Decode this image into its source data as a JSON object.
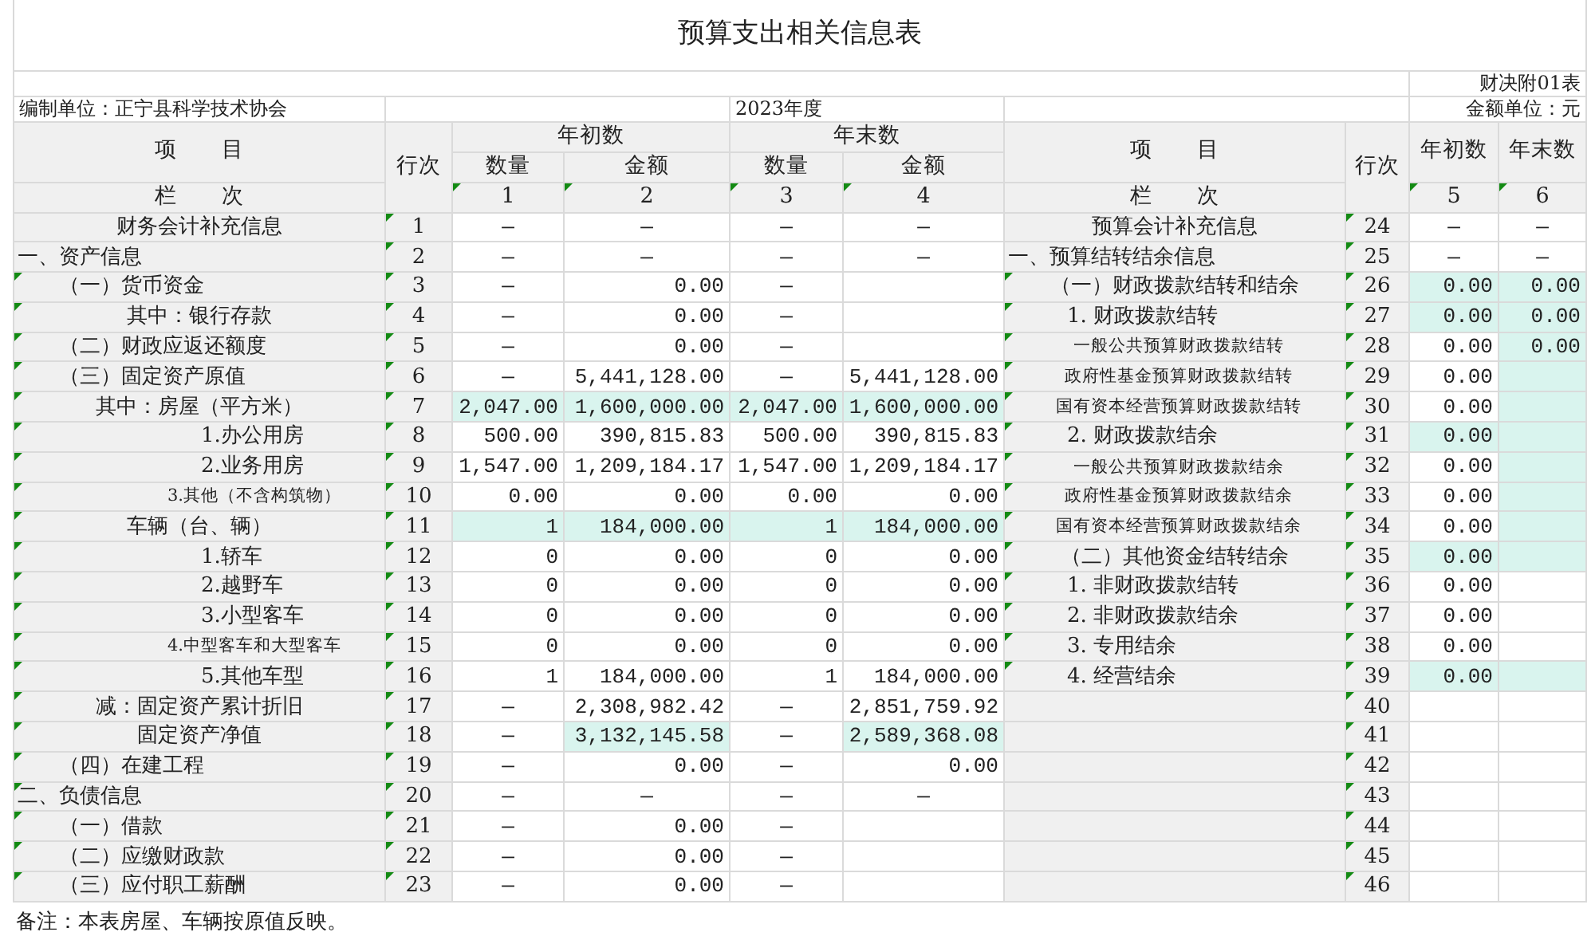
{
  "title": "预算支出相关信息表",
  "form_code": "财决附01表",
  "unit": "编制单位：正宁县科学技术协会",
  "period": "2023年度",
  "currency": "金额单位：元",
  "left_header": {
    "item": "项　　目",
    "line": "行次",
    "index_label": "栏　　次",
    "groups": [
      {
        "label": "年初数",
        "columns": [
          {
            "label": "数量",
            "index": "1",
            "marked": true
          },
          {
            "label": "金额",
            "index": "2",
            "marked": true
          }
        ]
      },
      {
        "label": "年末数",
        "columns": [
          {
            "label": "数量",
            "index": "3",
            "marked": true
          },
          {
            "label": "金额",
            "index": "4",
            "marked": true
          }
        ]
      }
    ]
  },
  "right_header": {
    "item": "项　　目",
    "line": "行次",
    "index_label": "栏　　次",
    "columns": [
      {
        "label": "年初数",
        "index": "5",
        "marked": true
      },
      {
        "label": "年末数",
        "index": "6",
        "marked": true
      }
    ]
  },
  "rows": [
    {
      "left": {
        "item": "财务会计补充信息",
        "kind": "center",
        "item_marked": false,
        "line": "1",
        "line_marked": true,
        "cells": [
          {
            "text": "—",
            "kind": "dash",
            "highlighted": false
          },
          {
            "text": "—",
            "kind": "dash",
            "highlighted": false
          },
          {
            "text": "—",
            "kind": "dash",
            "highlighted": false
          },
          {
            "text": "—",
            "kind": "dash",
            "highlighted": false
          }
        ]
      },
      "right": {
        "item": "预算会计补充信息",
        "kind": "center",
        "item_marked": false,
        "line": "24",
        "line_marked": true,
        "cells": [
          {
            "text": "—",
            "kind": "dash",
            "highlighted": false
          },
          {
            "text": "—",
            "kind": "dash",
            "highlighted": false
          }
        ]
      }
    },
    {
      "left": {
        "item": "一、资产信息",
        "kind": "section",
        "item_marked": false,
        "line": "2",
        "line_marked": true,
        "cells": [
          {
            "text": "—",
            "kind": "dash",
            "highlighted": false
          },
          {
            "text": "—",
            "kind": "dash",
            "highlighted": false
          },
          {
            "text": "—",
            "kind": "dash",
            "highlighted": false
          },
          {
            "text": "—",
            "kind": "dash",
            "highlighted": false
          }
        ]
      },
      "right": {
        "item": "一、预算结转结余信息",
        "kind": "section",
        "item_marked": false,
        "line": "25",
        "line_marked": true,
        "cells": [
          {
            "text": "—",
            "kind": "dash",
            "highlighted": false
          },
          {
            "text": "—",
            "kind": "dash",
            "highlighted": false
          }
        ]
      }
    },
    {
      "left": {
        "item": "（一）货币资金",
        "kind": "group",
        "item_marked": true,
        "line": "3",
        "line_marked": true,
        "cells": [
          {
            "text": "—",
            "kind": "dash",
            "highlighted": false
          },
          {
            "text": "0.00",
            "kind": "number",
            "highlighted": false
          },
          {
            "text": "—",
            "kind": "dash",
            "highlighted": false
          },
          {
            "kind": "blank",
            "highlighted": false
          }
        ]
      },
      "right": {
        "item": "（一）财政拨款结转和结余",
        "kind": "center",
        "item_marked": true,
        "line": "26",
        "line_marked": true,
        "cells": [
          {
            "text": "0.00",
            "kind": "number",
            "highlighted": true
          },
          {
            "text": "0.00",
            "kind": "number",
            "highlighted": true
          }
        ]
      }
    },
    {
      "left": {
        "item": "其中：银行存款",
        "kind": "center",
        "item_marked": true,
        "line": "4",
        "line_marked": true,
        "cells": [
          {
            "text": "—",
            "kind": "dash",
            "highlighted": false
          },
          {
            "text": "0.00",
            "kind": "number",
            "highlighted": false
          },
          {
            "text": "—",
            "kind": "dash",
            "highlighted": false
          },
          {
            "kind": "blank",
            "highlighted": false
          }
        ]
      },
      "right": {
        "item": "1. 财政拨款结转",
        "kind": "item",
        "item_marked": true,
        "line": "27",
        "line_marked": true,
        "cells": [
          {
            "text": "0.00",
            "kind": "number",
            "highlighted": true
          },
          {
            "text": "0.00",
            "kind": "number",
            "highlighted": true
          }
        ]
      }
    },
    {
      "left": {
        "item": "（二）财政应返还额度",
        "kind": "group",
        "item_marked": true,
        "line": "5",
        "line_marked": true,
        "cells": [
          {
            "text": "—",
            "kind": "dash",
            "highlighted": false
          },
          {
            "text": "0.00",
            "kind": "number",
            "highlighted": false
          },
          {
            "text": "—",
            "kind": "dash",
            "highlighted": false
          },
          {
            "kind": "blank",
            "highlighted": false
          }
        ]
      },
      "right": {
        "item": "一般公共预算财政拨款结转",
        "kind": "note",
        "item_marked": true,
        "line": "28",
        "line_marked": true,
        "cells": [
          {
            "text": "0.00",
            "kind": "number",
            "highlighted": false
          },
          {
            "text": "0.00",
            "kind": "number",
            "highlighted": true
          }
        ]
      }
    },
    {
      "left": {
        "item": "（三）固定资产原值",
        "kind": "group",
        "item_marked": true,
        "line": "6",
        "line_marked": true,
        "cells": [
          {
            "text": "—",
            "kind": "dash",
            "highlighted": false
          },
          {
            "text": "5,441,128.00",
            "kind": "number",
            "highlighted": false
          },
          {
            "text": "—",
            "kind": "dash",
            "highlighted": false
          },
          {
            "text": "5,441,128.00",
            "kind": "number",
            "highlighted": false
          }
        ]
      },
      "right": {
        "item": "政府性基金预算财政拨款结转",
        "kind": "note",
        "item_marked": true,
        "line": "29",
        "line_marked": true,
        "cells": [
          {
            "text": "0.00",
            "kind": "number",
            "highlighted": false
          },
          {
            "kind": "blank",
            "highlighted": true
          }
        ]
      }
    },
    {
      "left": {
        "item": "其中：房屋（平方米）",
        "kind": "center",
        "item_marked": true,
        "line": "7",
        "line_marked": true,
        "cells": [
          {
            "text": "2,047.00",
            "kind": "number",
            "highlighted": true
          },
          {
            "text": "1,600,000.00",
            "kind": "number",
            "highlighted": true
          },
          {
            "text": "2,047.00",
            "kind": "number",
            "highlighted": true
          },
          {
            "text": "1,600,000.00",
            "kind": "number",
            "highlighted": true
          }
        ]
      },
      "right": {
        "item": "国有资本经营预算财政拨款结转",
        "kind": "note",
        "item_marked": true,
        "line": "30",
        "line_marked": true,
        "cells": [
          {
            "text": "0.00",
            "kind": "number",
            "highlighted": false
          },
          {
            "kind": "blank",
            "highlighted": true
          }
        ]
      }
    },
    {
      "left": {
        "item": "1.办公用房",
        "kind": "item",
        "item_marked": true,
        "line": "8",
        "line_marked": true,
        "cells": [
          {
            "text": "500.00",
            "kind": "number",
            "highlighted": false
          },
          {
            "text": "390,815.83",
            "kind": "number",
            "highlighted": false
          },
          {
            "text": "500.00",
            "kind": "number",
            "highlighted": false
          },
          {
            "text": "390,815.83",
            "kind": "number",
            "highlighted": false
          }
        ]
      },
      "right": {
        "item": "2. 财政拨款结余",
        "kind": "item",
        "item_marked": true,
        "line": "31",
        "line_marked": true,
        "cells": [
          {
            "text": "0.00",
            "kind": "number",
            "highlighted": true
          },
          {
            "kind": "blank",
            "highlighted": true
          }
        ]
      }
    },
    {
      "left": {
        "item": "2.业务用房",
        "kind": "item",
        "item_marked": true,
        "line": "9",
        "line_marked": true,
        "cells": [
          {
            "text": "1,547.00",
            "kind": "number",
            "highlighted": false
          },
          {
            "text": "1,209,184.17",
            "kind": "number",
            "highlighted": false
          },
          {
            "text": "1,547.00",
            "kind": "number",
            "highlighted": false
          },
          {
            "text": "1,209,184.17",
            "kind": "number",
            "highlighted": false
          }
        ]
      },
      "right": {
        "item": "一般公共预算财政拨款结余",
        "kind": "note",
        "item_marked": true,
        "line": "32",
        "line_marked": true,
        "cells": [
          {
            "text": "0.00",
            "kind": "number",
            "highlighted": false
          },
          {
            "kind": "blank",
            "highlighted": true
          }
        ]
      }
    },
    {
      "left": {
        "item": "3.其他（不含构筑物）",
        "kind": "note",
        "item_marked": true,
        "line": "10",
        "line_marked": true,
        "cells": [
          {
            "text": "0.00",
            "kind": "number",
            "highlighted": false
          },
          {
            "text": "0.00",
            "kind": "number",
            "highlighted": false
          },
          {
            "text": "0.00",
            "kind": "number",
            "highlighted": false
          },
          {
            "text": "0.00",
            "kind": "number",
            "highlighted": false
          }
        ]
      },
      "right": {
        "item": "政府性基金预算财政拨款结余",
        "kind": "note",
        "item_marked": true,
        "line": "33",
        "line_marked": true,
        "cells": [
          {
            "text": "0.00",
            "kind": "number",
            "highlighted": false
          },
          {
            "kind": "blank",
            "highlighted": true
          }
        ]
      }
    },
    {
      "left": {
        "item": "车辆（台、辆）",
        "kind": "center",
        "item_marked": true,
        "line": "11",
        "line_marked": true,
        "cells": [
          {
            "text": "1",
            "kind": "number",
            "highlighted": true
          },
          {
            "text": "184,000.00",
            "kind": "number",
            "highlighted": true
          },
          {
            "text": "1",
            "kind": "number",
            "highlighted": true
          },
          {
            "text": "184,000.00",
            "kind": "number",
            "highlighted": true
          }
        ]
      },
      "right": {
        "item": "国有资本经营预算财政拨款结余",
        "kind": "note",
        "item_marked": true,
        "line": "34",
        "line_marked": true,
        "cells": [
          {
            "text": "0.00",
            "kind": "number",
            "highlighted": false
          },
          {
            "kind": "blank",
            "highlighted": true
          }
        ]
      }
    },
    {
      "left": {
        "item": "1.轿车",
        "kind": "item",
        "item_marked": true,
        "line": "12",
        "line_marked": true,
        "cells": [
          {
            "text": "0",
            "kind": "number",
            "highlighted": false
          },
          {
            "text": "0.00",
            "kind": "number",
            "highlighted": false
          },
          {
            "text": "0",
            "kind": "number",
            "highlighted": false
          },
          {
            "text": "0.00",
            "kind": "number",
            "highlighted": false
          }
        ]
      },
      "right": {
        "item": "（二）其他资金结转结余",
        "kind": "center",
        "item_marked": true,
        "line": "35",
        "line_marked": true,
        "cells": [
          {
            "text": "0.00",
            "kind": "number",
            "highlighted": true
          },
          {
            "kind": "blank",
            "highlighted": true
          }
        ]
      }
    },
    {
      "left": {
        "item": "2.越野车",
        "kind": "item",
        "item_marked": true,
        "line": "13",
        "line_marked": true,
        "cells": [
          {
            "text": "0",
            "kind": "number",
            "highlighted": false
          },
          {
            "text": "0.00",
            "kind": "number",
            "highlighted": false
          },
          {
            "text": "0",
            "kind": "number",
            "highlighted": false
          },
          {
            "text": "0.00",
            "kind": "number",
            "highlighted": false
          }
        ]
      },
      "right": {
        "item": "1. 非财政拨款结转",
        "kind": "item",
        "item_marked": true,
        "line": "36",
        "line_marked": true,
        "cells": [
          {
            "text": "0.00",
            "kind": "number",
            "highlighted": false
          },
          {
            "kind": "blank",
            "highlighted": false
          }
        ]
      }
    },
    {
      "left": {
        "item": "3.小型客车",
        "kind": "item",
        "item_marked": true,
        "line": "14",
        "line_marked": true,
        "cells": [
          {
            "text": "0",
            "kind": "number",
            "highlighted": false
          },
          {
            "text": "0.00",
            "kind": "number",
            "highlighted": false
          },
          {
            "text": "0",
            "kind": "number",
            "highlighted": false
          },
          {
            "text": "0.00",
            "kind": "number",
            "highlighted": false
          }
        ]
      },
      "right": {
        "item": "2. 非财政拨款结余",
        "kind": "item",
        "item_marked": true,
        "line": "37",
        "line_marked": true,
        "cells": [
          {
            "text": "0.00",
            "kind": "number",
            "highlighted": false
          },
          {
            "kind": "blank",
            "highlighted": false
          }
        ]
      }
    },
    {
      "left": {
        "item": "4.中型客车和大型客车",
        "kind": "note",
        "item_marked": true,
        "line": "15",
        "line_marked": true,
        "cells": [
          {
            "text": "0",
            "kind": "number",
            "highlighted": false
          },
          {
            "text": "0.00",
            "kind": "number",
            "highlighted": false
          },
          {
            "text": "0",
            "kind": "number",
            "highlighted": false
          },
          {
            "text": "0.00",
            "kind": "number",
            "highlighted": false
          }
        ]
      },
      "right": {
        "item": "3. 专用结余",
        "kind": "item",
        "item_marked": true,
        "line": "38",
        "line_marked": true,
        "cells": [
          {
            "text": "0.00",
            "kind": "number",
            "highlighted": false
          },
          {
            "kind": "blank",
            "highlighted": false
          }
        ]
      }
    },
    {
      "left": {
        "item": "5.其他车型",
        "kind": "item",
        "item_marked": true,
        "line": "16",
        "line_marked": true,
        "cells": [
          {
            "text": "1",
            "kind": "number",
            "highlighted": false
          },
          {
            "text": "184,000.00",
            "kind": "number",
            "highlighted": false
          },
          {
            "text": "1",
            "kind": "number",
            "highlighted": false
          },
          {
            "text": "184,000.00",
            "kind": "number",
            "highlighted": false
          }
        ]
      },
      "right": {
        "item": "4. 经营结余",
        "kind": "item",
        "item_marked": true,
        "line": "39",
        "line_marked": true,
        "cells": [
          {
            "text": "0.00",
            "kind": "number",
            "highlighted": true
          },
          {
            "kind": "blank",
            "highlighted": true
          }
        ]
      }
    },
    {
      "left": {
        "item": "减：固定资产累计折旧",
        "kind": "center",
        "item_marked": true,
        "line": "17",
        "line_marked": true,
        "cells": [
          {
            "text": "—",
            "kind": "dash",
            "highlighted": false
          },
          {
            "text": "2,308,982.42",
            "kind": "number",
            "highlighted": false
          },
          {
            "text": "—",
            "kind": "dash",
            "highlighted": false
          },
          {
            "text": "2,851,759.92",
            "kind": "number",
            "highlighted": false
          }
        ]
      },
      "right": {
        "kind": "blank",
        "item_marked": false,
        "line": "40",
        "line_marked": true,
        "cells": [
          {
            "kind": "blank",
            "highlighted": false
          },
          {
            "kind": "blank",
            "highlighted": false
          }
        ]
      }
    },
    {
      "left": {
        "item": "固定资产净值",
        "kind": "center",
        "item_marked": true,
        "line": "18",
        "line_marked": true,
        "cells": [
          {
            "text": "—",
            "kind": "dash",
            "highlighted": false
          },
          {
            "text": "3,132,145.58",
            "kind": "number",
            "highlighted": true
          },
          {
            "text": "—",
            "kind": "dash",
            "highlighted": false
          },
          {
            "text": "2,589,368.08",
            "kind": "number",
            "highlighted": true
          }
        ]
      },
      "right": {
        "kind": "blank",
        "item_marked": false,
        "line": "41",
        "line_marked": true,
        "cells": [
          {
            "kind": "blank",
            "highlighted": false
          },
          {
            "kind": "blank",
            "highlighted": false
          }
        ]
      }
    },
    {
      "left": {
        "item": "（四）在建工程",
        "kind": "group",
        "item_marked": true,
        "line": "19",
        "line_marked": true,
        "cells": [
          {
            "text": "—",
            "kind": "dash",
            "highlighted": false
          },
          {
            "text": "0.00",
            "kind": "number",
            "highlighted": false
          },
          {
            "text": "—",
            "kind": "dash",
            "highlighted": false
          },
          {
            "text": "0.00",
            "kind": "number",
            "highlighted": false
          }
        ]
      },
      "right": {
        "kind": "blank",
        "item_marked": false,
        "line": "42",
        "line_marked": true,
        "cells": [
          {
            "kind": "blank",
            "highlighted": false
          },
          {
            "kind": "blank",
            "highlighted": false
          }
        ]
      }
    },
    {
      "left": {
        "item": "二、负债信息",
        "kind": "section",
        "item_marked": true,
        "line": "20",
        "line_marked": true,
        "cells": [
          {
            "text": "—",
            "kind": "dash",
            "highlighted": false
          },
          {
            "text": "—",
            "kind": "dash",
            "highlighted": false
          },
          {
            "text": "—",
            "kind": "dash",
            "highlighted": false
          },
          {
            "text": "—",
            "kind": "dash",
            "highlighted": false
          }
        ]
      },
      "right": {
        "kind": "blank",
        "item_marked": false,
        "line": "43",
        "line_marked": true,
        "cells": [
          {
            "kind": "blank",
            "highlighted": false
          },
          {
            "kind": "blank",
            "highlighted": false
          }
        ]
      }
    },
    {
      "left": {
        "item": "（一）借款",
        "kind": "group",
        "item_marked": true,
        "line": "21",
        "line_marked": true,
        "cells": [
          {
            "text": "—",
            "kind": "dash",
            "highlighted": false
          },
          {
            "text": "0.00",
            "kind": "number",
            "highlighted": false
          },
          {
            "text": "—",
            "kind": "dash",
            "highlighted": false
          },
          {
            "kind": "blank",
            "highlighted": false
          }
        ]
      },
      "right": {
        "kind": "blank",
        "item_marked": false,
        "line": "44",
        "line_marked": true,
        "cells": [
          {
            "kind": "blank",
            "highlighted": false
          },
          {
            "kind": "blank",
            "highlighted": false
          }
        ]
      }
    },
    {
      "left": {
        "item": "（二）应缴财政款",
        "kind": "group",
        "item_marked": true,
        "line": "22",
        "line_marked": true,
        "cells": [
          {
            "text": "—",
            "kind": "dash",
            "highlighted": false
          },
          {
            "text": "0.00",
            "kind": "number",
            "highlighted": false
          },
          {
            "text": "—",
            "kind": "dash",
            "highlighted": false
          },
          {
            "kind": "blank",
            "highlighted": false
          }
        ]
      },
      "right": {
        "kind": "blank",
        "item_marked": false,
        "line": "45",
        "line_marked": true,
        "cells": [
          {
            "kind": "blank",
            "highlighted": false
          },
          {
            "kind": "blank",
            "highlighted": false
          }
        ]
      }
    },
    {
      "left": {
        "item": "（三）应付职工薪酬",
        "kind": "group",
        "item_marked": true,
        "line": "23",
        "line_marked": true,
        "cells": [
          {
            "text": "—",
            "kind": "dash",
            "highlighted": false
          },
          {
            "text": "0.00",
            "kind": "number",
            "highlighted": false
          },
          {
            "text": "—",
            "kind": "dash",
            "highlighted": false
          },
          {
            "kind": "blank",
            "highlighted": false
          }
        ]
      },
      "right": {
        "kind": "blank",
        "item_marked": false,
        "line": "46",
        "line_marked": true,
        "cells": [
          {
            "kind": "blank",
            "highlighted": false
          },
          {
            "kind": "blank",
            "highlighted": false
          }
        ]
      }
    }
  ],
  "note": "备注：本表房屋、车辆按原值反映。"
}
